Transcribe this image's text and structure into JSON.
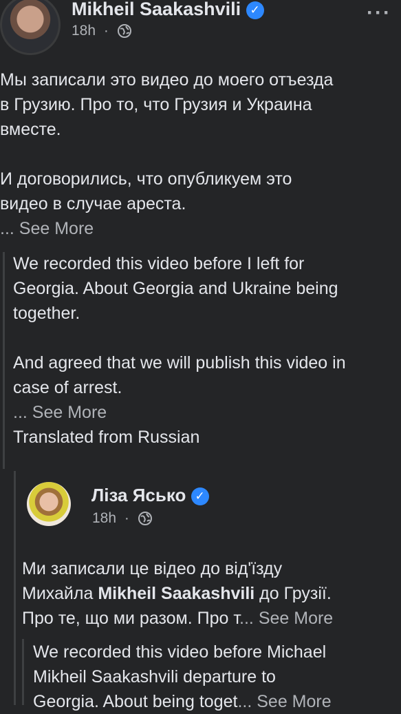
{
  "post": {
    "author": "Mikheil Saakashvili",
    "time": "18h",
    "separator": "·",
    "menu_icon": "more-horizontal-icon",
    "text_ru": [
      "Мы записали это видео до моего отъезда",
      "в Грузию. Про то, что Грузия и Украина",
      "вместе.",
      "",
      "И договорились, что опубликуем это",
      "видео в случае ареста."
    ],
    "ellipsis": "...",
    "see_more": "See More",
    "translation": [
      "We recorded this video before I left for",
      "Georgia. About Georgia and Ukraine being",
      "together.",
      "",
      "And agreed that we will publish this video in",
      "case of arrest."
    ],
    "translated_from": "Translated from Russian"
  },
  "shared": {
    "author": "Ліза Ясько",
    "time": "18h",
    "separator": "·",
    "text_uk_1": "Ми записали це відео до від'їзду",
    "text_uk_2a": "Михайла ",
    "text_uk_2b": "Mikheil Saakashvili",
    "text_uk_2c": "  до Грузії.",
    "text_uk_3": "Про те, що ми разом. Про т",
    "ellipsis": "...",
    "see_more": "See More",
    "translation_1": "We recorded this video before Michael",
    "translation_2": "Mikheil Saakashvili departure to",
    "translation_3": "Georgia. About being toget",
    "translation_ellipsis": "...",
    "translation_see_more": "See More"
  },
  "colors": {
    "background": "#242527",
    "text": "#e4e6eb",
    "secondary": "#b0b3b8",
    "verified": "#2d88ff"
  }
}
